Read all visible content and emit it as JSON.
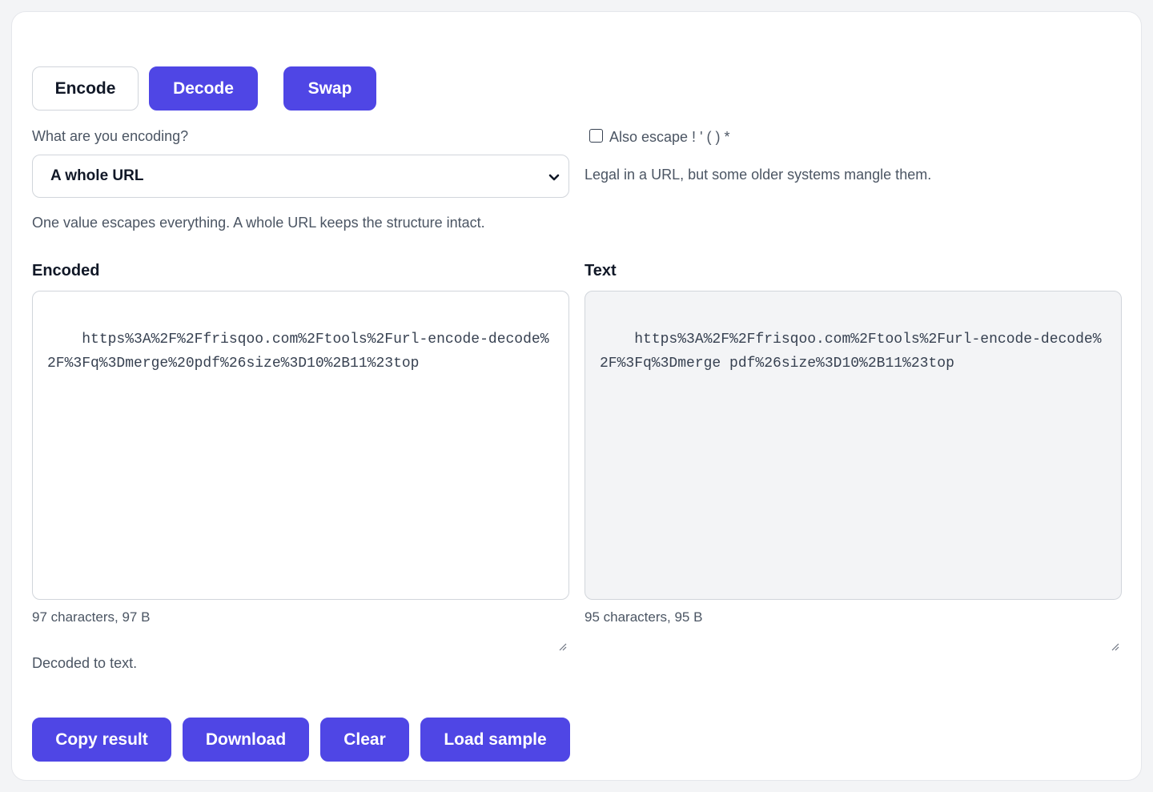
{
  "mode_buttons": {
    "encode": "Encode",
    "decode": "Decode",
    "swap": "Swap"
  },
  "encoding_select": {
    "label": "What are you encoding?",
    "selected": "A whole URL",
    "hint": "One value escapes everything. A whole URL keeps the structure intact."
  },
  "escape_option": {
    "label": "Also escape ! ' ( ) *",
    "checked": false,
    "hint": "Legal in a URL, but some older systems mangle them."
  },
  "encoded_panel": {
    "title": "Encoded",
    "value": "https%3A%2F%2Ffrisqoo.com%2Ftools%2Furl-encode-decode%2F%3Fq%3Dmerge%20pdf%26size%3D10%2B11%23top",
    "stats": "97 characters, 97 B"
  },
  "text_panel": {
    "title": "Text",
    "value": "https%3A%2F%2Ffrisqoo.com%2Ftools%2Furl-encode-decode%2F%3Fq%3Dmerge pdf%26size%3D10%2B11%23top",
    "stats": "95 characters, 95 B"
  },
  "status": "Decoded to text.",
  "actions": {
    "copy": "Copy result",
    "download": "Download",
    "clear": "Clear",
    "load_sample": "Load sample"
  },
  "colors": {
    "accent": "#4f46e5",
    "border": "#d1d5db",
    "muted_text": "#4b5563",
    "readonly_bg": "#f3f4f6"
  },
  "icons": {
    "select_chevron": "chevron-down-icon",
    "resize_grip": "resize-grip-icon"
  }
}
